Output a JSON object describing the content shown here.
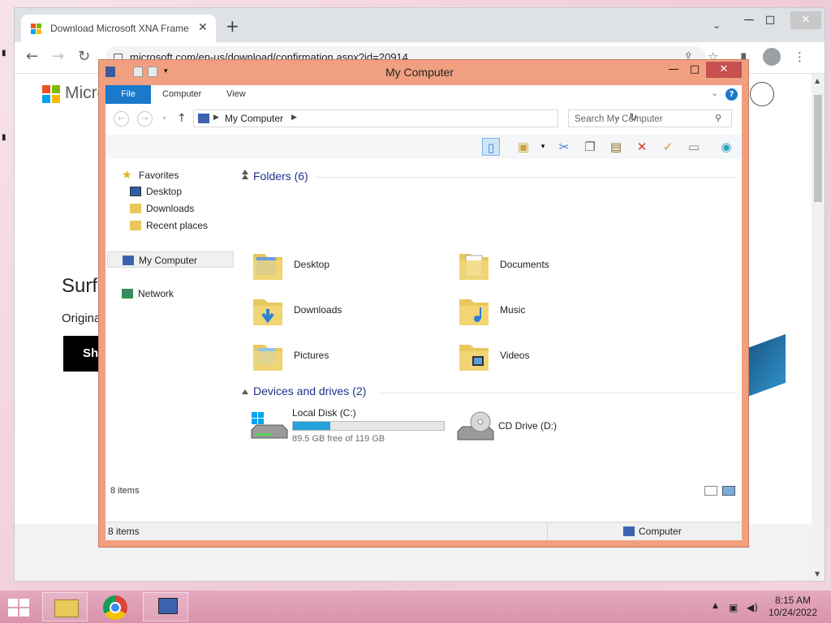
{
  "browser": {
    "tab_title": "Download Microsoft XNA Frame",
    "tab_close": "✕",
    "new_tab": "+",
    "url": "microsoft.com/en-us/download/confirmation.aspx?id=20914",
    "win_min": "—",
    "win_max": "□",
    "win_close": "✕"
  },
  "page": {
    "brand": "Micro",
    "hero_title": "Surfa",
    "hero_subtitle": "Origina",
    "hero_button": "Sho"
  },
  "explorer": {
    "title": "My Computer",
    "win_min": "—",
    "win_max": "□",
    "win_close": "✕",
    "ribbon_tabs": [
      "File",
      "Computer",
      "View"
    ],
    "help": "?",
    "address_text": "My Computer",
    "search_placeholder": "Search My Computer",
    "nav": {
      "favorites": "Favorites",
      "desktop": "Desktop",
      "downloads": "Downloads",
      "recent": "Recent places",
      "computer": "My Computer",
      "network": "Network"
    },
    "folders_header": "Folders (6)",
    "folders": [
      "Desktop",
      "Documents",
      "Downloads",
      "Music",
      "Pictures",
      "Videos"
    ],
    "drives_header": "Devices and drives (2)",
    "drive_c": {
      "name": "Local Disk (C:)",
      "free": "89.5 GB free of 119 GB",
      "used_fraction": 0.248
    },
    "drive_d": {
      "name": "CD Drive (D:)"
    },
    "items_count": "8 items",
    "status_left": "8 items",
    "status_right": "Computer"
  },
  "taskbar": {
    "time": "8:15 AM",
    "date": "10/24/2022"
  }
}
